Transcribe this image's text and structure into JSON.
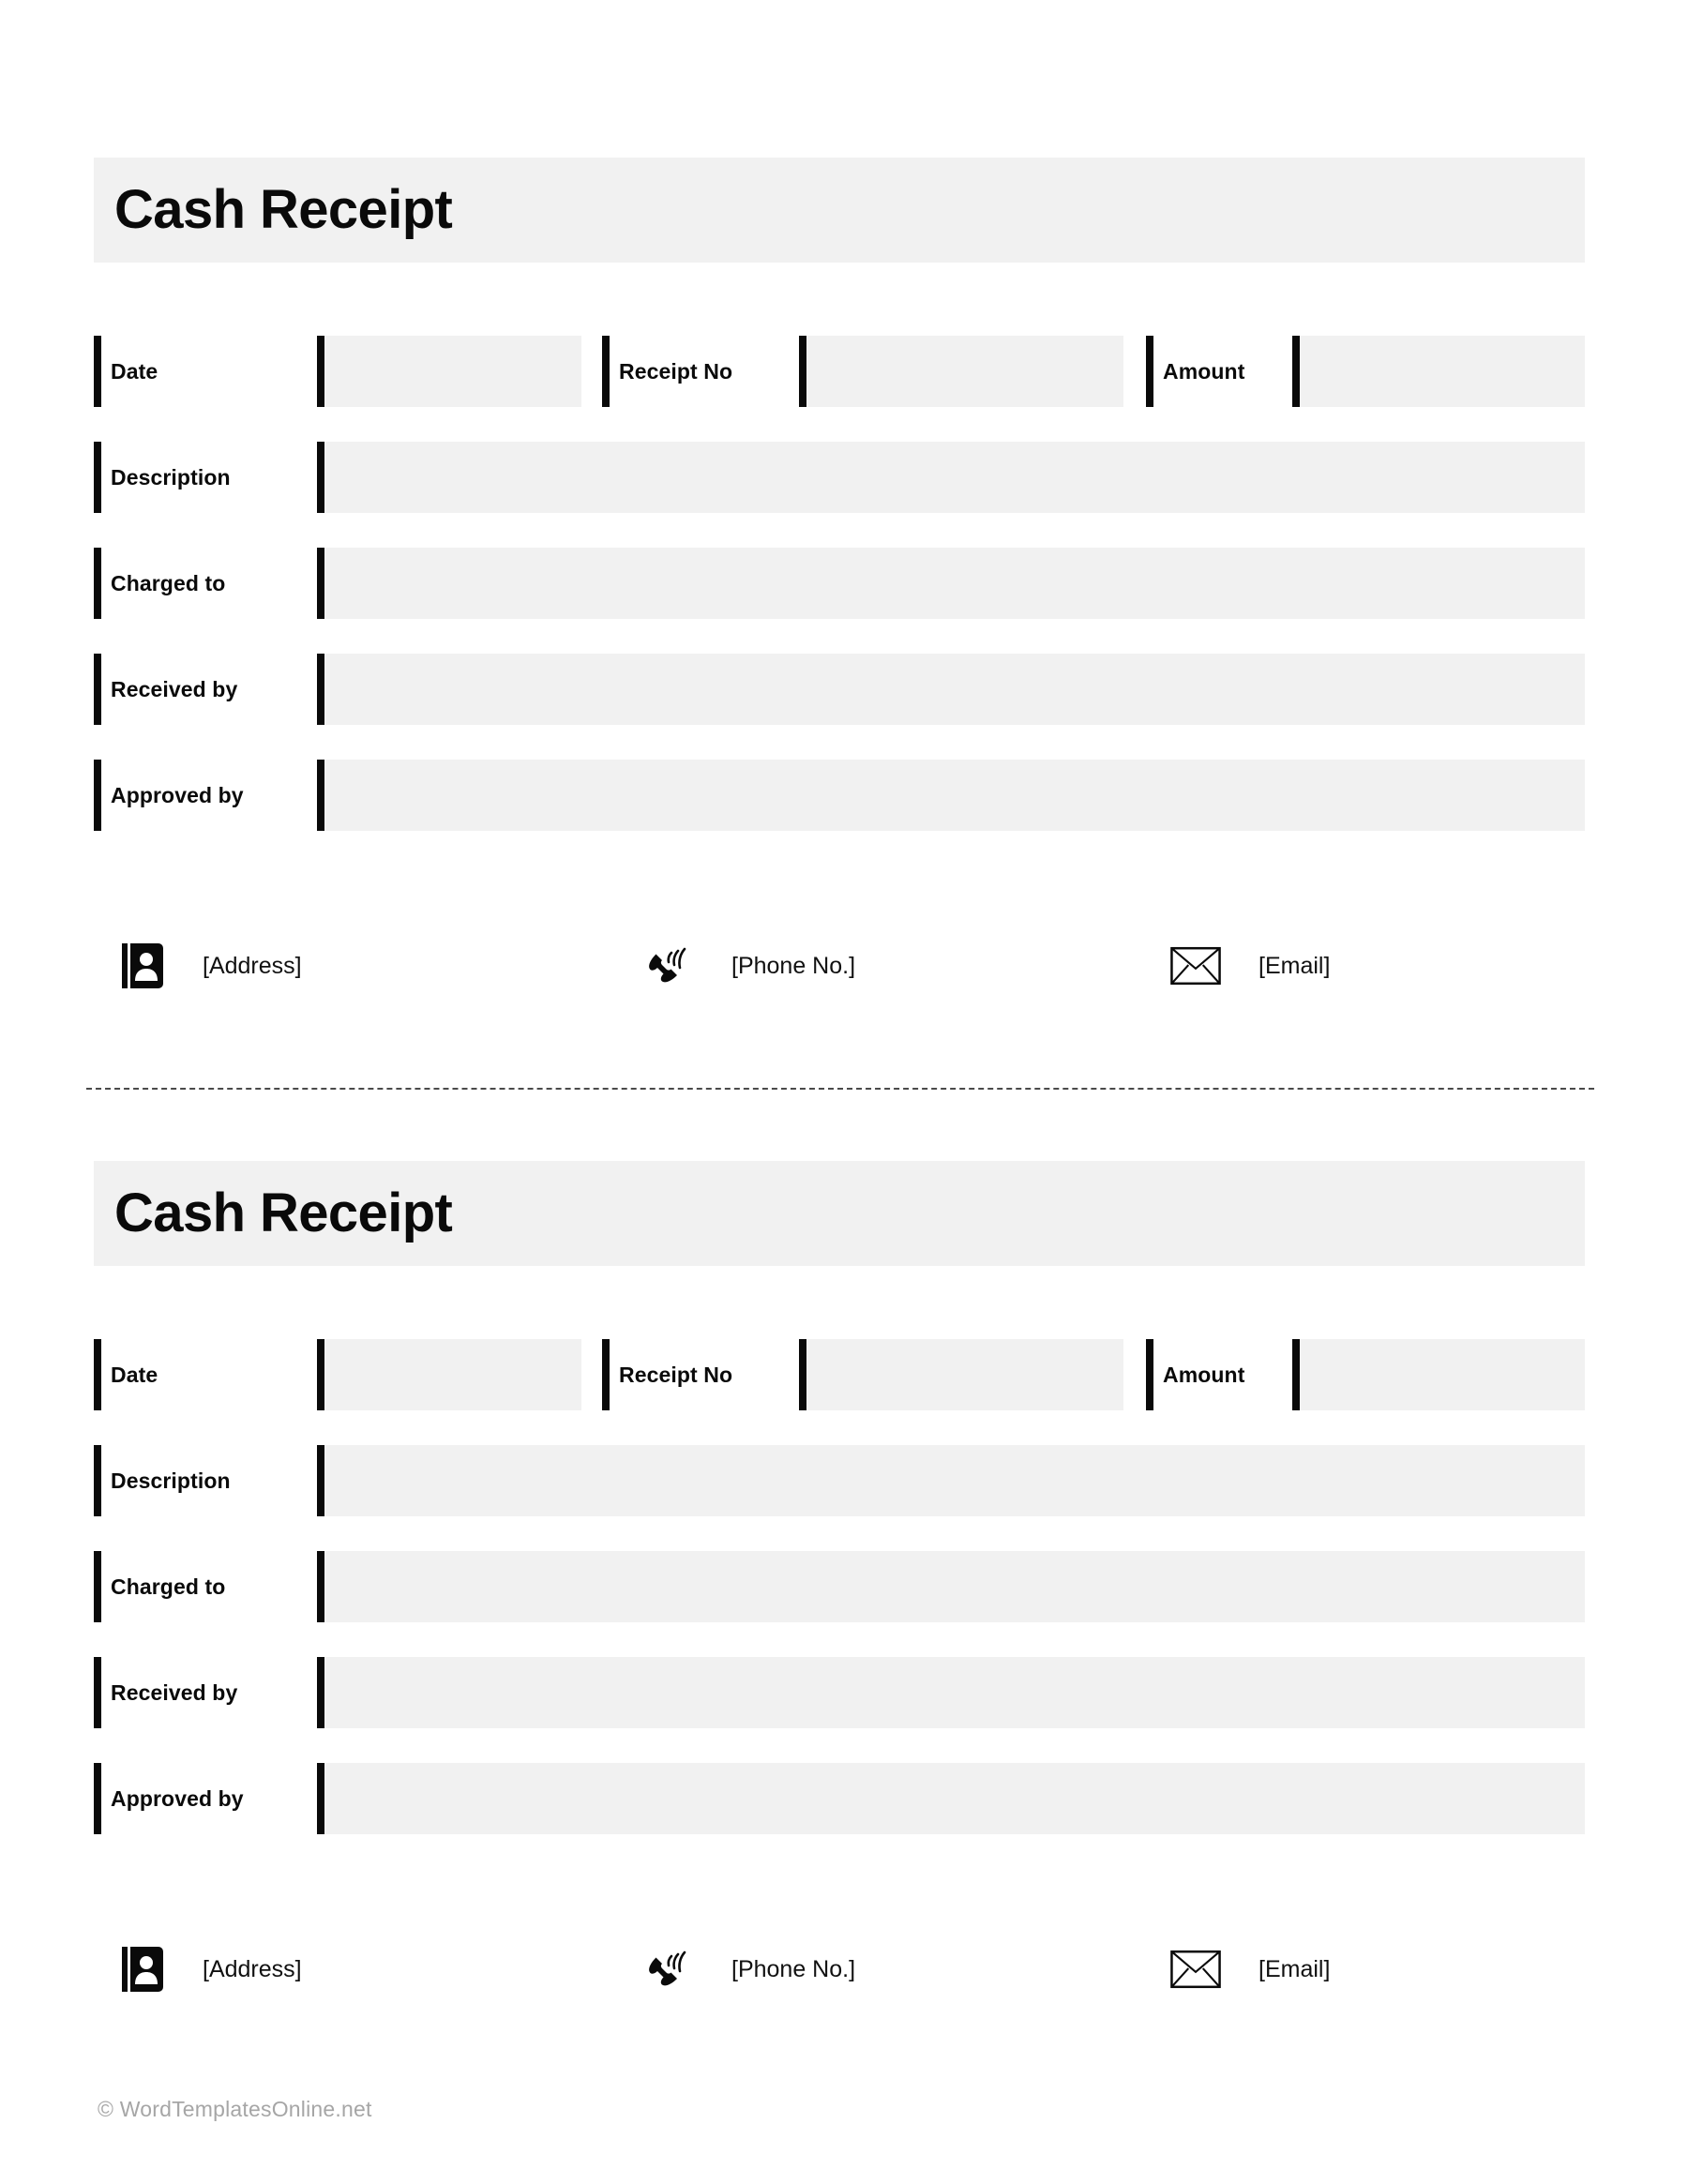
{
  "document": {
    "title": "Cash Receipt",
    "footer_credit": "© WordTemplatesOnline.net"
  },
  "colors": {
    "field_fill": "#F1F1F1",
    "bar": "#0A0A0A",
    "text": "#0A0A0A",
    "credit_text": "#A6A6A6",
    "divider": "#4A4A4A",
    "background": "#FFFFFF"
  },
  "receipts": [
    {
      "title": "Cash Receipt",
      "rows": [
        {
          "cells": [
            {
              "label": "Date",
              "value": ""
            },
            {
              "label": "Receipt No",
              "value": ""
            },
            {
              "label": "Amount",
              "value": ""
            }
          ]
        },
        {
          "label": "Description",
          "value": ""
        },
        {
          "label": "Charged to",
          "value": ""
        },
        {
          "label": "Received by",
          "value": ""
        },
        {
          "label": "Approved by",
          "value": ""
        }
      ],
      "contact": [
        {
          "icon": "address-book-icon",
          "label": "[Address]"
        },
        {
          "icon": "phone-ringing-icon",
          "label": "[Phone No.]"
        },
        {
          "icon": "envelope-icon",
          "label": "[Email]"
        }
      ]
    },
    {
      "title": "Cash Receipt",
      "rows": [
        {
          "cells": [
            {
              "label": "Date",
              "value": ""
            },
            {
              "label": "Receipt No",
              "value": ""
            },
            {
              "label": "Amount",
              "value": ""
            }
          ]
        },
        {
          "label": "Description",
          "value": ""
        },
        {
          "label": "Charged to",
          "value": ""
        },
        {
          "label": "Received by",
          "value": ""
        },
        {
          "label": "Approved by",
          "value": ""
        }
      ],
      "contact": [
        {
          "icon": "address-book-icon",
          "label": "[Address]"
        },
        {
          "icon": "phone-ringing-icon",
          "label": "[Phone No.]"
        },
        {
          "icon": "envelope-icon",
          "label": "[Email]"
        }
      ]
    }
  ]
}
